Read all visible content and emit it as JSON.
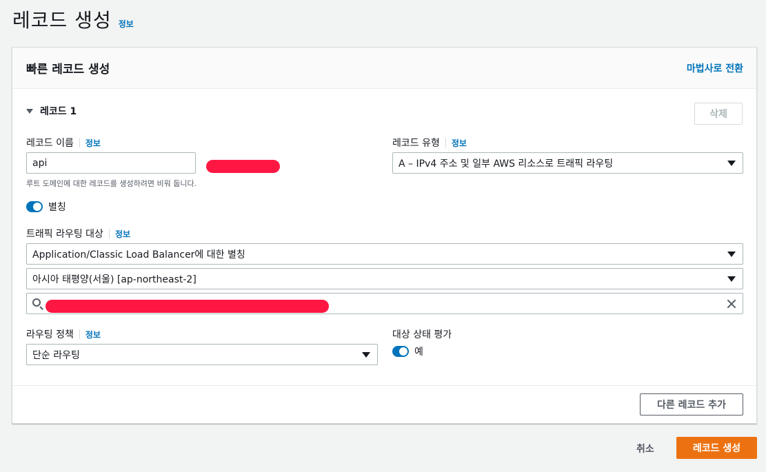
{
  "page": {
    "title": "레코드 생성",
    "info": "정보"
  },
  "panel": {
    "title": "빠른 레코드 생성",
    "switch_link": "마법사로 전환",
    "record_title": "레코드 1",
    "delete_label": "삭제"
  },
  "record_name": {
    "label": "레코드 이름",
    "info": "정보",
    "value": "api",
    "hint": "루트 도메인에 대한 레코드를 생성하려면 비워 둡니다."
  },
  "record_type": {
    "label": "레코드 유형",
    "info": "정보",
    "value": "A – IPv4 주소 및 일부 AWS 리소스로 트래픽 라우팅"
  },
  "alias": {
    "label": "별칭",
    "enabled": true
  },
  "traffic_target": {
    "label": "트래픽 라우팅 대상",
    "info": "정보",
    "endpoint": "Application/Classic Load Balancer에 대한 별칭",
    "region": "아시아 태평양(서울) [ap-northeast-2]",
    "search_value": ""
  },
  "routing_policy": {
    "label": "라우팅 정책",
    "info": "정보",
    "value": "단순 라우팅"
  },
  "health": {
    "label": "대상 상태 평가",
    "value": "예",
    "enabled": true
  },
  "footer": {
    "add_record": "다른 레코드 추가"
  },
  "actions": {
    "cancel": "취소",
    "create": "레코드 생성"
  },
  "colors": {
    "primary": "#ec7211",
    "link": "#0073bb",
    "redaction": "#ff1744"
  }
}
